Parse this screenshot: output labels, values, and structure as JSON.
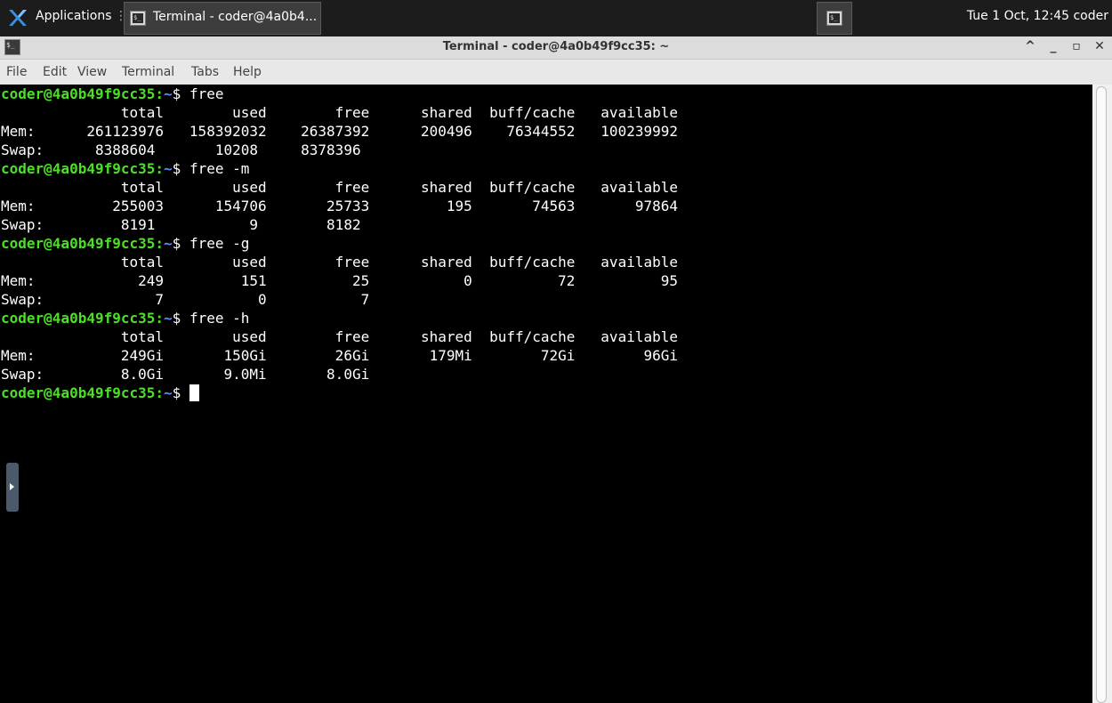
{
  "taskbar": {
    "applications_label": "Applications",
    "separator": "⋮",
    "task_label": "Terminal - coder@4a0b4...",
    "clock": "Tue  1 Oct, 12:45 coder"
  },
  "window": {
    "title": "Terminal - coder@4a0b49f9cc35: ~",
    "controls": [
      "^",
      "_",
      "▫",
      "✕"
    ]
  },
  "menu": {
    "items": [
      "File",
      "Edit",
      "View",
      "Terminal",
      "Tabs",
      "Help"
    ]
  },
  "terminal": {
    "prompt_user_host": "coder@4a0b49f9cc35",
    "prompt_sep": ":",
    "prompt_path": "~",
    "prompt_symbol": "$ ",
    "lines": [
      {
        "type": "cmd",
        "text": "free"
      },
      {
        "type": "out",
        "text": "              total        used        free      shared  buff/cache   available"
      },
      {
        "type": "out",
        "text": "Mem:      261123976   158392032    26387392      200496    76344552   100239992"
      },
      {
        "type": "out",
        "text": "Swap:      8388604       10208     8378396"
      },
      {
        "type": "cmd",
        "text": "free -m"
      },
      {
        "type": "out",
        "text": "              total        used        free      shared  buff/cache   available"
      },
      {
        "type": "out",
        "text": "Mem:         255003      154706       25733         195       74563       97864"
      },
      {
        "type": "out",
        "text": "Swap:         8191           9        8182"
      },
      {
        "type": "cmd",
        "text": "free -g"
      },
      {
        "type": "out",
        "text": "              total        used        free      shared  buff/cache   available"
      },
      {
        "type": "out",
        "text": "Mem:            249         151          25           0          72          95"
      },
      {
        "type": "out",
        "text": "Swap:             7           0           7"
      },
      {
        "type": "cmd",
        "text": "free -h"
      },
      {
        "type": "out",
        "text": "              total        used        free      shared  buff/cache   available"
      },
      {
        "type": "out",
        "text": "Mem:          249Gi       150Gi        26Gi       179Mi        72Gi        96Gi"
      },
      {
        "type": "out",
        "text": "Swap:         8.0Gi       9.0Mi       8.0Gi"
      },
      {
        "type": "cmd",
        "text": ""
      }
    ]
  }
}
